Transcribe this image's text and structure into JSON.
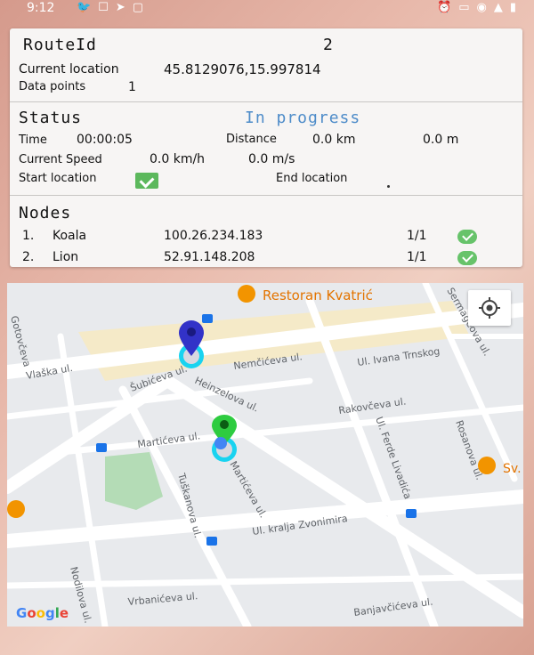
{
  "status_bar": {
    "time": "9:12"
  },
  "route": {
    "label": "RouteId",
    "value": "2"
  },
  "current_location": {
    "label": "Current location",
    "value": "45.8129076,15.997814"
  },
  "data_points": {
    "label": "Data points",
    "value": "1"
  },
  "status": {
    "label": "Status",
    "state": "In progress",
    "time_label": "Time",
    "time_value": "00:00:05",
    "distance_label": "Distance",
    "distance_km": "0.0 km",
    "distance_m": "0.0 m",
    "speed_label": "Current Speed",
    "speed_kmh": "0.0 km/h",
    "speed_ms": "0.0 m/s",
    "start_label": "Start location",
    "end_label": "End location"
  },
  "nodes": {
    "title": "Nodes",
    "items": [
      {
        "num": "1.",
        "name": "Koala",
        "ip": "100.26.234.183",
        "ratio": "1/1"
      },
      {
        "num": "2.",
        "name": "Lion",
        "ip": "52.91.148.208",
        "ratio": "1/1"
      }
    ]
  },
  "map": {
    "poi": {
      "restaurant": "Restoran Kvatrić",
      "sv": "Sv."
    },
    "streets": {
      "vlaska": "Vlaška ul.",
      "subiceva": "Šubićeva ul.",
      "nemciceva": "Nemčićeva ul.",
      "ivana": "Ul. Ivana Trnskog",
      "heinzelova": "Heinzelova ul.",
      "rakovceva": "Rakovčeva ul.",
      "ferde": "Ul. Ferde Livadića",
      "marticeva": "Martićeva ul.",
      "rosanova": "Rosanova ul.",
      "tuskanova": "Tuškanova ul.",
      "marticeva2": "Martićeva ul.",
      "zvonimira": "Ul. kralja Zvonimira",
      "nodilova": "Nodilova ul.",
      "vrbaniceva": "Vrbanićeva ul.",
      "banjavciceva": "Banjavčićeva ul.",
      "gotovceva": "Gotovčeva",
      "sermageova": "Sermageova ul."
    },
    "logo": "Google",
    "colors": {
      "blue_marker": "#3232c8",
      "green_marker": "#2ecc40",
      "accuracy_ring": "#19d3f0"
    }
  }
}
